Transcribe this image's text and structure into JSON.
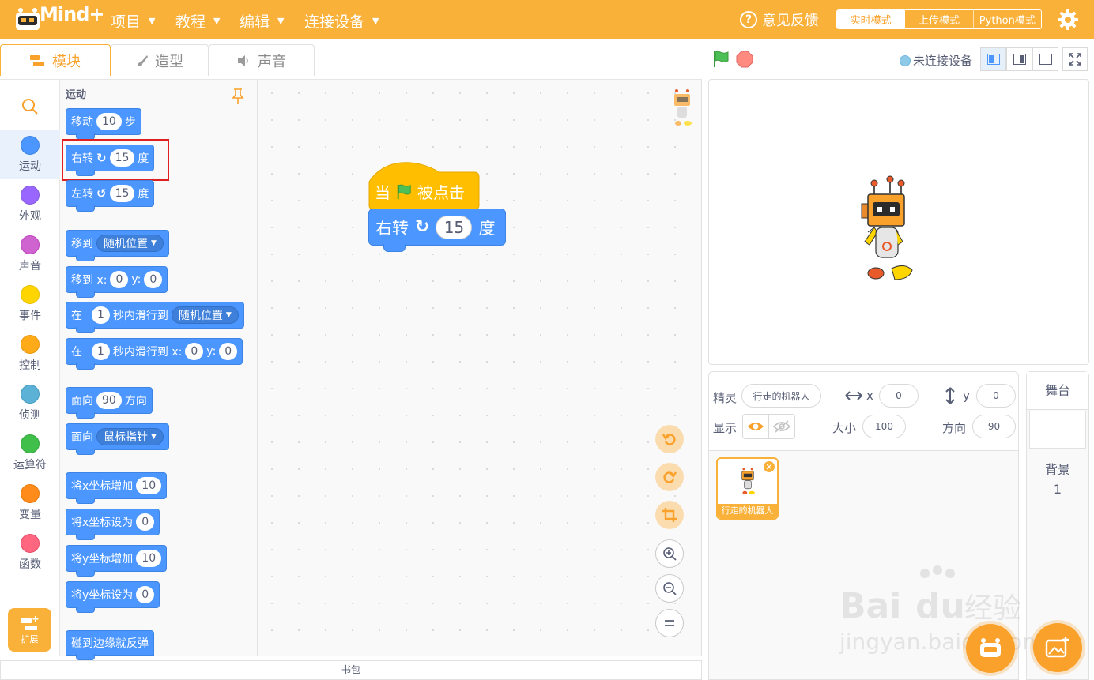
{
  "app": {
    "logo_text": "Mind+"
  },
  "menu": [
    {
      "label": "项目"
    },
    {
      "label": "教程"
    },
    {
      "label": "编辑"
    },
    {
      "label": "连接设备"
    }
  ],
  "header": {
    "feedback": "意见反馈",
    "modes": [
      "实时模式",
      "上传模式",
      "Python模式"
    ],
    "active_mode": "实时模式"
  },
  "tabs": [
    "模块",
    "造型",
    "声音"
  ],
  "stage_bar": {
    "connection": "未连接设备"
  },
  "categories": [
    {
      "label": "运动",
      "color": "#4c97ff"
    },
    {
      "label": "外观",
      "color": "#9966ff"
    },
    {
      "label": "声音",
      "color": "#cf63cf"
    },
    {
      "label": "事件",
      "color": "#ffd500"
    },
    {
      "label": "控制",
      "color": "#ffab19"
    },
    {
      "label": "侦测",
      "color": "#5cb1d6"
    },
    {
      "label": "运算符",
      "color": "#40bf4a"
    },
    {
      "label": "变量",
      "color": "#ff8c1a"
    },
    {
      "label": "函数",
      "color": "#ff6680"
    }
  ],
  "extensions_label": "扩展",
  "palette": {
    "title": "运动",
    "move": {
      "a": "移动",
      "v": "10",
      "b": "步"
    },
    "turn_right": {
      "a": "右转",
      "v": "15",
      "b": "度"
    },
    "turn_left": {
      "a": "左转",
      "v": "15",
      "b": "度"
    },
    "goto": {
      "a": "移到",
      "dd": "随机位置"
    },
    "goto_xy": {
      "a": "移到 x:",
      "x": "0",
      "b": "y:",
      "y": "0"
    },
    "glide": {
      "a": "在",
      "v": "1",
      "b": "秒内滑行到",
      "dd": "随机位置"
    },
    "glide_xy": {
      "a": "在",
      "v": "1",
      "b": "秒内滑行到 x:",
      "x": "0",
      "c": "y:",
      "y": "0"
    },
    "point_dir": {
      "a": "面向",
      "v": "90",
      "b": "方向"
    },
    "point_towards": {
      "a": "面向",
      "dd": "鼠标指针"
    },
    "change_x": {
      "a": "将x坐标增加",
      "v": "10"
    },
    "set_x": {
      "a": "将x坐标设为",
      "v": "0"
    },
    "change_y": {
      "a": "将y坐标增加",
      "v": "10"
    },
    "set_y": {
      "a": "将y坐标设为",
      "v": "0"
    },
    "bounce": {
      "a": "碰到边缘就反弹"
    }
  },
  "script": {
    "hat": {
      "a": "当",
      "b": "被点击"
    },
    "turn": {
      "a": "右转",
      "v": "15",
      "b": "度"
    }
  },
  "bag_label": "书包",
  "sprite": {
    "label_sprite": "精灵",
    "name": "行走的机器人",
    "label_x": "x",
    "x": "0",
    "label_y": "y",
    "y": "0",
    "label_show": "显示",
    "label_size": "大小",
    "size": "100",
    "label_dir": "方向",
    "direction": "90",
    "thumb_name": "行走的机器人"
  },
  "stage_panel": {
    "title": "舞台",
    "backdrop_label": "背景",
    "backdrop_count": "1"
  },
  "watermark": {
    "brand": "Bai du 经验",
    "url": "jingyan.baidu.com"
  },
  "colors": {
    "brand_orange": "#f9b13a",
    "motion_blue": "#4c97ff",
    "event_yellow": "#ffbf00"
  }
}
